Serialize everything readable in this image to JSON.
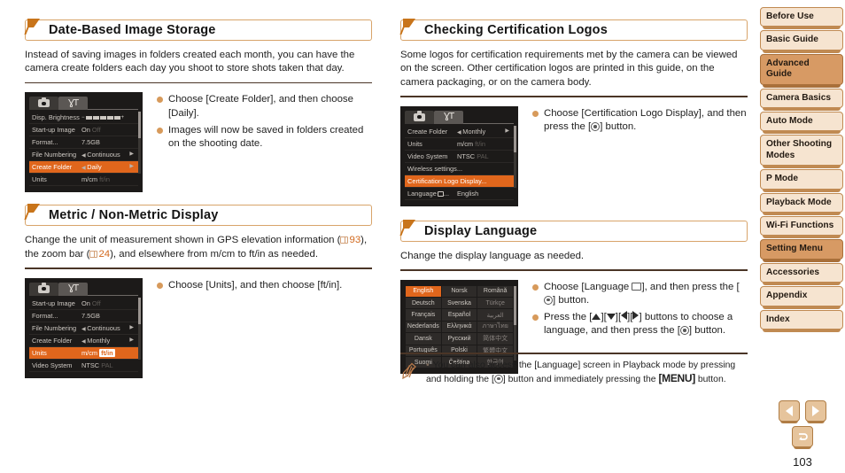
{
  "page_number": "103",
  "colors": {
    "accent_orange": "#e0661c",
    "header_border": "#d8a46a",
    "rule": "#4a3526",
    "nav_fill": "#f6e4d0",
    "nav_active": "#d79a64",
    "bullet_dot": "#d79a5b"
  },
  "sections": [
    {
      "id": "date-based-image-storage",
      "title": "Date-Based Image Storage",
      "body": "Instead of saving images in folders created each month, you can have the camera create folders each day you shoot to store shots taken that day.",
      "screen": {
        "type": "menu",
        "tabs": [
          "camera-icon",
          "tools-icon"
        ],
        "rows": [
          {
            "label": "Disp. Brightness",
            "value": "",
            "widget": "brightness-slider",
            "selected": false
          },
          {
            "label": "Start-up Image",
            "value": "On",
            "value_dim": "Off",
            "selected": false
          },
          {
            "label": "Format...",
            "value": "7.5GB",
            "selected": false
          },
          {
            "label": "File Numbering",
            "value": "Continuous",
            "arrows": true,
            "selected": false
          },
          {
            "label": "Create Folder",
            "value": "Daily",
            "arrows": true,
            "selected": true
          },
          {
            "label": "Units",
            "value": "m/cm",
            "value_dim": "ft/in",
            "selected": false
          }
        ]
      },
      "bullets": [
        {
          "parts": [
            {
              "t": "text",
              "v": "Choose [Create Folder], and then choose [Daily]."
            }
          ]
        },
        {
          "parts": [
            {
              "t": "text",
              "v": "Images will now be saved in folders created on the shooting date."
            }
          ]
        }
      ]
    },
    {
      "id": "metric-non-metric-display",
      "title": "Metric / Non-Metric Display",
      "body_parts": [
        {
          "t": "text",
          "v": "Change the unit of measurement shown in GPS elevation information ("
        },
        {
          "t": "pgref",
          "v": "93"
        },
        {
          "t": "text",
          "v": "), the zoom bar ("
        },
        {
          "t": "pgref",
          "v": "24"
        },
        {
          "t": "text",
          "v": "), and elsewhere from m/cm to ft/in as needed."
        }
      ],
      "screen": {
        "type": "menu",
        "tabs": [
          "camera-icon",
          "tools-icon"
        ],
        "rows": [
          {
            "label": "Start-up Image",
            "value": "On",
            "value_dim": "Off",
            "selected": false
          },
          {
            "label": "Format...",
            "value": "7.5GB",
            "selected": false
          },
          {
            "label": "File Numbering",
            "value": "Continuous",
            "arrows": true,
            "selected": false
          },
          {
            "label": "Create Folder",
            "value": "Monthly",
            "arrows": true,
            "selected": false
          },
          {
            "label": "Units",
            "value": "m/cm",
            "value_chip": "ft/in",
            "selected": true
          },
          {
            "label": "Video System",
            "value": "NTSC",
            "value_dim": "PAL",
            "selected": false
          }
        ]
      },
      "bullets": [
        {
          "parts": [
            {
              "t": "text",
              "v": "Choose [Units], and then choose [ft/in]."
            }
          ]
        }
      ]
    },
    {
      "id": "checking-certification-logos",
      "title": "Checking Certification Logos",
      "body": "Some logos for certification requirements met by the camera can be viewed on the screen. Other certification logos are printed in this guide, on the camera packaging, or on the camera body.",
      "screen": {
        "type": "menu",
        "tabs": [
          "camera-icon",
          "tools-icon"
        ],
        "rows": [
          {
            "label": "Create Folder",
            "value": "Monthly",
            "arrows": true,
            "selected": false
          },
          {
            "label": "Units",
            "value": "m/cm",
            "value_dim": "ft/in",
            "selected": false
          },
          {
            "label": "Video System",
            "value": "NTSC",
            "value_dim": "PAL",
            "selected": false
          },
          {
            "label": "Wireless settings...",
            "value": "",
            "full": true,
            "selected": false
          },
          {
            "label": "Certification Logo Display...",
            "value": "",
            "full": true,
            "selected": true
          },
          {
            "label": "Language",
            "label_icon": "language-icon",
            "label_suffix": "...",
            "value": "English",
            "selected": false
          }
        ]
      },
      "bullets": [
        {
          "parts": [
            {
              "t": "text",
              "v": "Choose [Certification Logo Display], and then press the ["
            },
            {
              "t": "btn",
              "v": "func-set-button"
            },
            {
              "t": "text",
              "v": "] button."
            }
          ]
        }
      ]
    },
    {
      "id": "display-language",
      "title": "Display Language",
      "body": "Change the display language as needed.",
      "screen": {
        "type": "language-grid",
        "languages": [
          "English",
          "Norsk",
          "Română",
          "Deutsch",
          "Svenska",
          "Türkçe",
          "Français",
          "Español",
          "العربية",
          "Nederlands",
          "Ελληνικά",
          "ภาษาไทย",
          "Dansk",
          "Русский",
          "简体中文",
          "Português",
          "Polski",
          "繁體中文",
          "Suomi",
          "Čeština",
          "한국어"
        ],
        "selected_index": 0
      },
      "bullets": [
        {
          "parts": [
            {
              "t": "text",
              "v": "Choose [Language "
            },
            {
              "t": "langicon",
              "v": "language-icon"
            },
            {
              "t": "text",
              "v": "], and then press the ["
            },
            {
              "t": "btn",
              "v": "func-set-button"
            },
            {
              "t": "text",
              "v": "] button."
            }
          ]
        },
        {
          "parts": [
            {
              "t": "text",
              "v": "Press the ["
            },
            {
              "t": "dir",
              "v": "up"
            },
            {
              "t": "text",
              "v": "]["
            },
            {
              "t": "dir",
              "v": "down"
            },
            {
              "t": "text",
              "v": "]["
            },
            {
              "t": "dir",
              "v": "left"
            },
            {
              "t": "text",
              "v": "]["
            },
            {
              "t": "dir",
              "v": "right"
            },
            {
              "t": "text",
              "v": "] buttons to choose a language, and then press the ["
            },
            {
              "t": "btn",
              "v": "func-set-button"
            },
            {
              "t": "text",
              "v": "] button."
            }
          ]
        }
      ]
    }
  ],
  "note": {
    "icon": "pencil-icon",
    "parts": [
      {
        "t": "text",
        "v": "You can also access the [Language] screen in Playback mode by pressing and holding the ["
      },
      {
        "t": "btn",
        "v": "func-set-button"
      },
      {
        "t": "text",
        "v": "] button and immediately pressing the "
      },
      {
        "t": "menu",
        "v": "MENU"
      },
      {
        "t": "text",
        "v": " button."
      }
    ]
  },
  "sidebar": {
    "items": [
      {
        "label": "Before Use",
        "active": false
      },
      {
        "label": "Basic Guide",
        "active": false
      },
      {
        "label": "Advanced Guide",
        "active": true
      },
      {
        "label": "Camera Basics",
        "active": false
      },
      {
        "label": "Auto Mode",
        "active": false
      },
      {
        "label": "Other Shooting Modes",
        "active": false
      },
      {
        "label": "P Mode",
        "active": false
      },
      {
        "label": "Playback Mode",
        "active": false
      },
      {
        "label": "Wi-Fi Functions",
        "active": false
      },
      {
        "label": "Setting Menu",
        "active": true
      },
      {
        "label": "Accessories",
        "active": false
      },
      {
        "label": "Appendix",
        "active": false
      },
      {
        "label": "Index",
        "active": false
      }
    ]
  },
  "bottom_nav": {
    "prev": "previous-page-arrow",
    "next": "next-page-arrow",
    "return": "return-button"
  }
}
